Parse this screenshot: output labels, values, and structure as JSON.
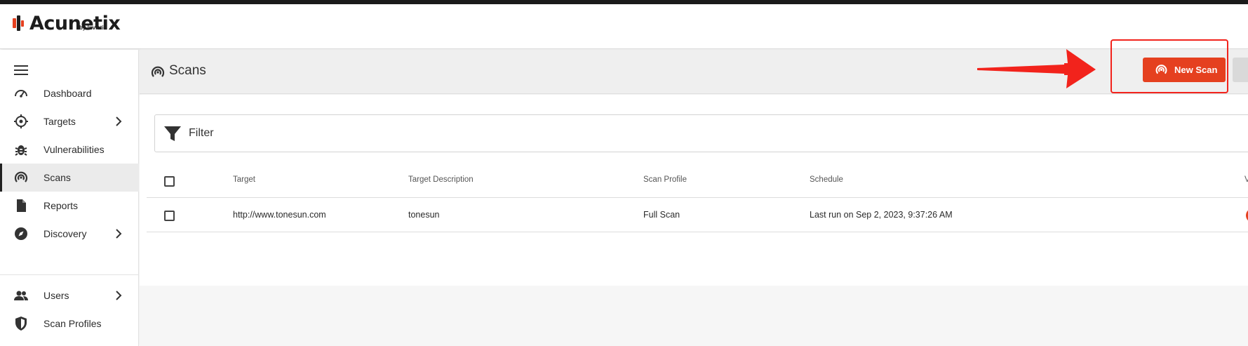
{
  "app": {
    "logo_text": "Acunetix",
    "logo_sub": "by Invicti"
  },
  "sidebar": {
    "items": [
      {
        "label": "Dashboard",
        "icon": "dashboard-icon"
      },
      {
        "label": "Targets",
        "icon": "target-icon"
      },
      {
        "label": "Vulnerabilities",
        "icon": "bug-icon"
      },
      {
        "label": "Scans",
        "icon": "scan-icon"
      },
      {
        "label": "Reports",
        "icon": "report-icon"
      },
      {
        "label": "Discovery",
        "icon": "compass-icon"
      },
      {
        "label": "Users",
        "icon": "users-icon"
      },
      {
        "label": "Scan Profiles",
        "icon": "shield-icon"
      }
    ],
    "active": "Scans"
  },
  "header": {
    "title": "Scans",
    "new_scan_label": "New Scan"
  },
  "filter": {
    "label": "Filter"
  },
  "table": {
    "columns": [
      "Target",
      "Target Description",
      "Scan Profile",
      "Schedule",
      "V"
    ],
    "rows": [
      {
        "target": "http://www.tonesun.com",
        "description": "tonesun",
        "profile": "Full Scan",
        "schedule": "Last run on Sep 2, 2023, 9:37:26 AM"
      }
    ]
  },
  "colors": {
    "accent": "#e5401f",
    "annotation": "#f2231c",
    "active_bg": "#ebebeb"
  }
}
